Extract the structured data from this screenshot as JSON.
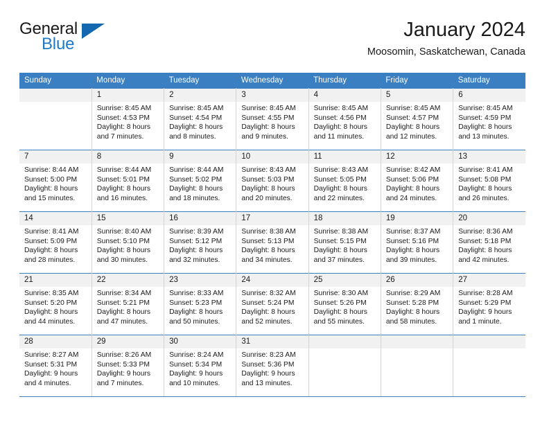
{
  "logo": {
    "primary_text": "General",
    "secondary_text": "Blue",
    "triangle_icon": "blue-triangle-icon",
    "primary_color": "#1a1a1a",
    "secondary_color": "#2079c4"
  },
  "header": {
    "title": "January 2024",
    "subtitle": "Moosomin, Saskatchewan, Canada"
  },
  "theme": {
    "header_bg": "#3a7fc1",
    "header_text": "#ffffff",
    "daynum_bg": "#f1f1f1",
    "cell_bg": "#ffffff",
    "grid_line": "#d4d4d4",
    "week_divider": "#3a7fc1"
  },
  "weekday_headers": [
    "Sunday",
    "Monday",
    "Tuesday",
    "Wednesday",
    "Thursday",
    "Friday",
    "Saturday"
  ],
  "labels": {
    "sunrise_prefix": "Sunrise:",
    "sunset_prefix": "Sunset:",
    "daylight_prefix": "Daylight:"
  },
  "weeks": [
    [
      {
        "day": "",
        "empty": true
      },
      {
        "day": "1",
        "sunrise": "Sunrise: 8:45 AM",
        "sunset": "Sunset: 4:53 PM",
        "daylight_line1": "Daylight: 8 hours",
        "daylight_line2": "and 7 minutes."
      },
      {
        "day": "2",
        "sunrise": "Sunrise: 8:45 AM",
        "sunset": "Sunset: 4:54 PM",
        "daylight_line1": "Daylight: 8 hours",
        "daylight_line2": "and 8 minutes."
      },
      {
        "day": "3",
        "sunrise": "Sunrise: 8:45 AM",
        "sunset": "Sunset: 4:55 PM",
        "daylight_line1": "Daylight: 8 hours",
        "daylight_line2": "and 9 minutes."
      },
      {
        "day": "4",
        "sunrise": "Sunrise: 8:45 AM",
        "sunset": "Sunset: 4:56 PM",
        "daylight_line1": "Daylight: 8 hours",
        "daylight_line2": "and 11 minutes."
      },
      {
        "day": "5",
        "sunrise": "Sunrise: 8:45 AM",
        "sunset": "Sunset: 4:57 PM",
        "daylight_line1": "Daylight: 8 hours",
        "daylight_line2": "and 12 minutes."
      },
      {
        "day": "6",
        "sunrise": "Sunrise: 8:45 AM",
        "sunset": "Sunset: 4:59 PM",
        "daylight_line1": "Daylight: 8 hours",
        "daylight_line2": "and 13 minutes."
      }
    ],
    [
      {
        "day": "7",
        "sunrise": "Sunrise: 8:44 AM",
        "sunset": "Sunset: 5:00 PM",
        "daylight_line1": "Daylight: 8 hours",
        "daylight_line2": "and 15 minutes."
      },
      {
        "day": "8",
        "sunrise": "Sunrise: 8:44 AM",
        "sunset": "Sunset: 5:01 PM",
        "daylight_line1": "Daylight: 8 hours",
        "daylight_line2": "and 16 minutes."
      },
      {
        "day": "9",
        "sunrise": "Sunrise: 8:44 AM",
        "sunset": "Sunset: 5:02 PM",
        "daylight_line1": "Daylight: 8 hours",
        "daylight_line2": "and 18 minutes."
      },
      {
        "day": "10",
        "sunrise": "Sunrise: 8:43 AM",
        "sunset": "Sunset: 5:03 PM",
        "daylight_line1": "Daylight: 8 hours",
        "daylight_line2": "and 20 minutes."
      },
      {
        "day": "11",
        "sunrise": "Sunrise: 8:43 AM",
        "sunset": "Sunset: 5:05 PM",
        "daylight_line1": "Daylight: 8 hours",
        "daylight_line2": "and 22 minutes."
      },
      {
        "day": "12",
        "sunrise": "Sunrise: 8:42 AM",
        "sunset": "Sunset: 5:06 PM",
        "daylight_line1": "Daylight: 8 hours",
        "daylight_line2": "and 24 minutes."
      },
      {
        "day": "13",
        "sunrise": "Sunrise: 8:41 AM",
        "sunset": "Sunset: 5:08 PM",
        "daylight_line1": "Daylight: 8 hours",
        "daylight_line2": "and 26 minutes."
      }
    ],
    [
      {
        "day": "14",
        "sunrise": "Sunrise: 8:41 AM",
        "sunset": "Sunset: 5:09 PM",
        "daylight_line1": "Daylight: 8 hours",
        "daylight_line2": "and 28 minutes."
      },
      {
        "day": "15",
        "sunrise": "Sunrise: 8:40 AM",
        "sunset": "Sunset: 5:10 PM",
        "daylight_line1": "Daylight: 8 hours",
        "daylight_line2": "and 30 minutes."
      },
      {
        "day": "16",
        "sunrise": "Sunrise: 8:39 AM",
        "sunset": "Sunset: 5:12 PM",
        "daylight_line1": "Daylight: 8 hours",
        "daylight_line2": "and 32 minutes."
      },
      {
        "day": "17",
        "sunrise": "Sunrise: 8:38 AM",
        "sunset": "Sunset: 5:13 PM",
        "daylight_line1": "Daylight: 8 hours",
        "daylight_line2": "and 34 minutes."
      },
      {
        "day": "18",
        "sunrise": "Sunrise: 8:38 AM",
        "sunset": "Sunset: 5:15 PM",
        "daylight_line1": "Daylight: 8 hours",
        "daylight_line2": "and 37 minutes."
      },
      {
        "day": "19",
        "sunrise": "Sunrise: 8:37 AM",
        "sunset": "Sunset: 5:16 PM",
        "daylight_line1": "Daylight: 8 hours",
        "daylight_line2": "and 39 minutes."
      },
      {
        "day": "20",
        "sunrise": "Sunrise: 8:36 AM",
        "sunset": "Sunset: 5:18 PM",
        "daylight_line1": "Daylight: 8 hours",
        "daylight_line2": "and 42 minutes."
      }
    ],
    [
      {
        "day": "21",
        "sunrise": "Sunrise: 8:35 AM",
        "sunset": "Sunset: 5:20 PM",
        "daylight_line1": "Daylight: 8 hours",
        "daylight_line2": "and 44 minutes."
      },
      {
        "day": "22",
        "sunrise": "Sunrise: 8:34 AM",
        "sunset": "Sunset: 5:21 PM",
        "daylight_line1": "Daylight: 8 hours",
        "daylight_line2": "and 47 minutes."
      },
      {
        "day": "23",
        "sunrise": "Sunrise: 8:33 AM",
        "sunset": "Sunset: 5:23 PM",
        "daylight_line1": "Daylight: 8 hours",
        "daylight_line2": "and 50 minutes."
      },
      {
        "day": "24",
        "sunrise": "Sunrise: 8:32 AM",
        "sunset": "Sunset: 5:24 PM",
        "daylight_line1": "Daylight: 8 hours",
        "daylight_line2": "and 52 minutes."
      },
      {
        "day": "25",
        "sunrise": "Sunrise: 8:30 AM",
        "sunset": "Sunset: 5:26 PM",
        "daylight_line1": "Daylight: 8 hours",
        "daylight_line2": "and 55 minutes."
      },
      {
        "day": "26",
        "sunrise": "Sunrise: 8:29 AM",
        "sunset": "Sunset: 5:28 PM",
        "daylight_line1": "Daylight: 8 hours",
        "daylight_line2": "and 58 minutes."
      },
      {
        "day": "27",
        "sunrise": "Sunrise: 8:28 AM",
        "sunset": "Sunset: 5:29 PM",
        "daylight_line1": "Daylight: 9 hours",
        "daylight_line2": "and 1 minute."
      }
    ],
    [
      {
        "day": "28",
        "sunrise": "Sunrise: 8:27 AM",
        "sunset": "Sunset: 5:31 PM",
        "daylight_line1": "Daylight: 9 hours",
        "daylight_line2": "and 4 minutes."
      },
      {
        "day": "29",
        "sunrise": "Sunrise: 8:26 AM",
        "sunset": "Sunset: 5:33 PM",
        "daylight_line1": "Daylight: 9 hours",
        "daylight_line2": "and 7 minutes."
      },
      {
        "day": "30",
        "sunrise": "Sunrise: 8:24 AM",
        "sunset": "Sunset: 5:34 PM",
        "daylight_line1": "Daylight: 9 hours",
        "daylight_line2": "and 10 minutes."
      },
      {
        "day": "31",
        "sunrise": "Sunrise: 8:23 AM",
        "sunset": "Sunset: 5:36 PM",
        "daylight_line1": "Daylight: 9 hours",
        "daylight_line2": "and 13 minutes."
      },
      {
        "day": "",
        "empty": true
      },
      {
        "day": "",
        "empty": true
      },
      {
        "day": "",
        "empty": true
      }
    ]
  ]
}
